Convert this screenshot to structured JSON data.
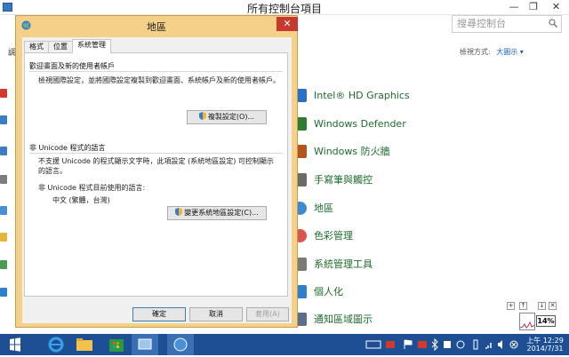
{
  "control_panel": {
    "title": "所有控制台項目",
    "window_controls": {
      "minimize": "—",
      "restore": "❐",
      "close": "✕"
    },
    "search_placeholder": "搜尋控制台",
    "left_edge_label": "調",
    "view_by_label": "檢視方式:",
    "view_by_value": "大圖示 ▾",
    "items": [
      {
        "label": "Intel® HD Graphics",
        "icon": "intel-graphics-icon",
        "color": "#2a6fc9"
      },
      {
        "label": "Windows Defender",
        "icon": "defender-icon",
        "color": "#2e7d32"
      },
      {
        "label": "Windows 防火牆",
        "icon": "firewall-icon",
        "color": "#b5541c"
      },
      {
        "label": "手寫筆與觸控",
        "icon": "pen-touch-icon",
        "color": "#6b6b6b"
      },
      {
        "label": "地區",
        "icon": "region-icon",
        "color": "#3b8ad8"
      },
      {
        "label": "色彩管理",
        "icon": "color-management-icon",
        "color": "#d9534f"
      },
      {
        "label": "系統管理工具",
        "icon": "admin-tools-icon",
        "color": "#7a7a7a"
      },
      {
        "label": "個人化",
        "icon": "personalization-icon",
        "color": "#2f7fd1"
      },
      {
        "label": "通知區域圖示",
        "icon": "notification-icons-icon",
        "color": "#5a6e8c"
      }
    ]
  },
  "dialog": {
    "title": "地區",
    "close_glyph": "✕",
    "tabs": [
      {
        "label": "格式",
        "active": false
      },
      {
        "label": "位置",
        "active": false
      },
      {
        "label": "系統管理",
        "active": true
      }
    ],
    "welcome_group": {
      "title": "歡迎畫面及新的使用者帳戶",
      "description": "檢視國際設定，並將國際設定複製到歡迎畫面、系統帳戶及新的使用者帳戶。",
      "button": "複製設定(O)..."
    },
    "unicode_group": {
      "title": "非 Unicode 程式的語言",
      "description": "不支援 Unicode 的程式顯示文字時，此項設定 (系統地區設定) 可控制顯示的語言。",
      "current_label": "非 Unicode 程式目前使用的語言:",
      "current_value": "中文 (繁體，台灣)",
      "button": "變更系統地區設定(C)..."
    },
    "buttons": {
      "ok": "確定",
      "cancel": "取消",
      "apply": "套用(A)"
    }
  },
  "side_widgets": {
    "meter_value": "14%"
  },
  "taskbar": {
    "apps": [
      {
        "name": "start-button"
      },
      {
        "name": "internet-explorer-icon"
      },
      {
        "name": "file-explorer-icon"
      },
      {
        "name": "store-icon"
      },
      {
        "name": "control-panel-icon"
      },
      {
        "name": "region-app-icon"
      }
    ],
    "time": "上午 12:29",
    "date": "2014/7/31"
  },
  "colors": {
    "taskbar": "#1e4f95",
    "dialog_frame": "#f4d088",
    "close_red": "#c7382f",
    "link_green": "#1e6b2e"
  }
}
